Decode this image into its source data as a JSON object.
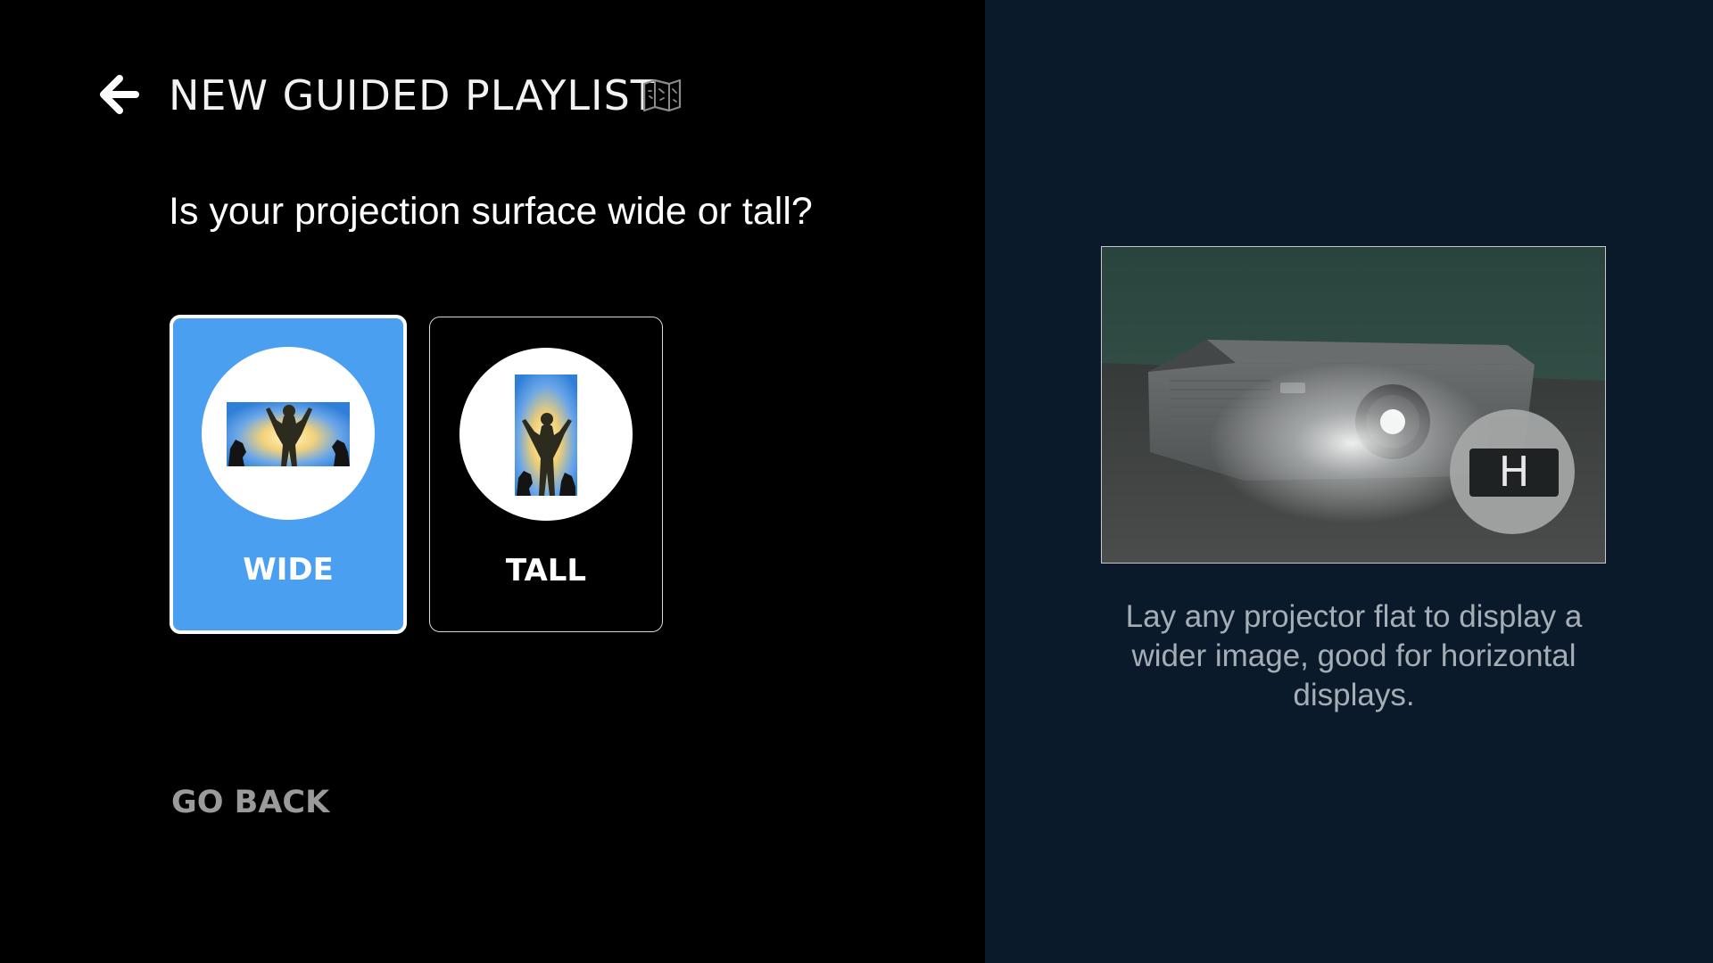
{
  "header": {
    "title": "NEW GUIDED PLAYLIST",
    "back_icon": "arrow-left-icon",
    "map_icon": "map-icon"
  },
  "question": "Is your projection surface wide or tall?",
  "options": [
    {
      "label": "WIDE",
      "selected": true,
      "icon": "wide-surface-illustration"
    },
    {
      "label": "TALL",
      "selected": false,
      "icon": "tall-surface-illustration"
    }
  ],
  "go_back_label": "GO BACK",
  "preview": {
    "badge_letter": "H",
    "caption": "Lay any projector flat to display a wider image, good for horizontal displays."
  },
  "colors": {
    "selected_card": "#4a9ff0",
    "right_panel_bg": "#0a1a2b",
    "left_panel_bg": "#000000"
  }
}
